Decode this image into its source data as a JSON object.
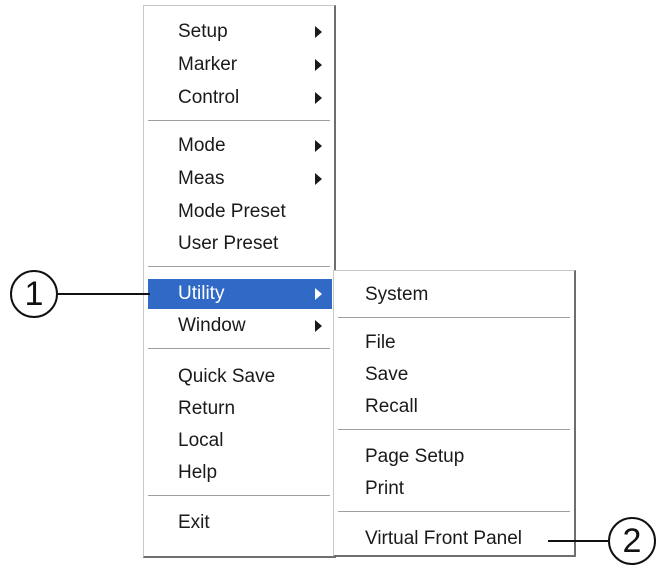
{
  "main_menu": {
    "items": [
      {
        "label": "Setup"
      },
      {
        "label": "Marker"
      },
      {
        "label": "Control"
      },
      {
        "label": "Mode"
      },
      {
        "label": "Meas"
      },
      {
        "label": "Mode Preset"
      },
      {
        "label": "User Preset"
      },
      {
        "label": "Utility"
      },
      {
        "label": "Window"
      },
      {
        "label": "Quick Save"
      },
      {
        "label": "Return"
      },
      {
        "label": "Local"
      },
      {
        "label": "Help"
      },
      {
        "label": "Exit"
      }
    ],
    "selected": "Utility"
  },
  "utility_submenu": {
    "items": [
      {
        "label": "System"
      },
      {
        "label": "File"
      },
      {
        "label": "Save"
      },
      {
        "label": "Recall"
      },
      {
        "label": "Page Setup"
      },
      {
        "label": "Print"
      },
      {
        "label": "Virtual Front Panel"
      }
    ]
  },
  "callouts": [
    {
      "label": "1"
    },
    {
      "label": "2"
    }
  ],
  "colors": {
    "selection": "#3169c6",
    "text": "#1a1a1a"
  }
}
